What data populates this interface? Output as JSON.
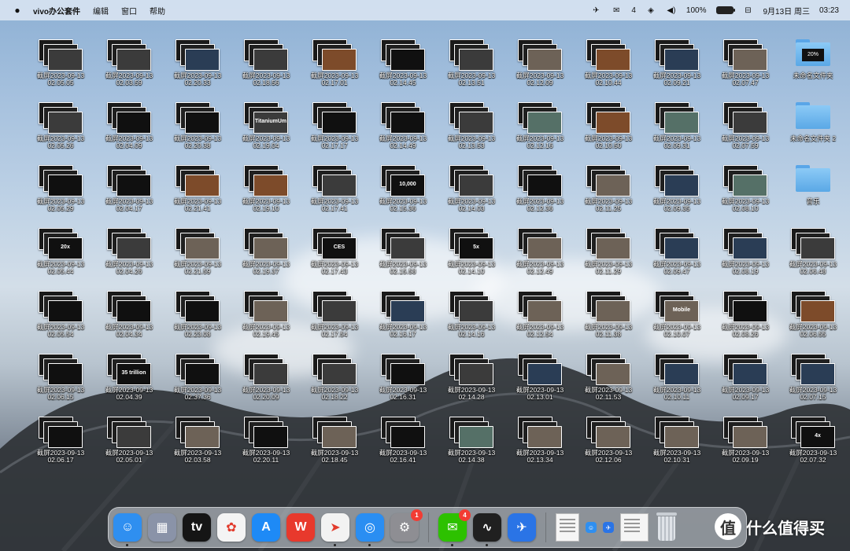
{
  "menubar": {
    "app_name": "vivo办公套件",
    "menus": [
      "编辑",
      "窗口",
      "帮助"
    ],
    "wechat_count": "4",
    "battery": "100%",
    "date": "9月13日 周三",
    "time": "03:23"
  },
  "desktop": {
    "columns": [
      [
        {
          "n1": "截屏",
          "n2": "2023-09-13",
          "n3": "02.05.05",
          "thumb": "",
          "v": 1
        },
        {
          "n1": "截屏",
          "n2": "2023-09-13",
          "n3": "02.05.26",
          "thumb": "",
          "v": 1
        },
        {
          "n1": "截屏",
          "n2": "2023-09-13",
          "n3": "02.05.29",
          "thumb": "",
          "v": 0
        },
        {
          "n1": "截屏",
          "n2": "2023-09-13",
          "n3": "02.05.44",
          "thumb": "20x",
          "v": 0
        },
        {
          "n1": "截屏",
          "n2": "2023-09-13",
          "n3": "02.05.54",
          "thumb": "",
          "v": 0
        },
        {
          "n1": "截屏",
          "n2": "2023-09-13",
          "n3": "02.06.15",
          "thumb": "",
          "v": 0
        },
        {
          "n1": "截屏",
          "n2": "2023-09-13",
          "n3": "02.06.17",
          "thumb": "",
          "v": 0
        }
      ],
      [
        {
          "n1": "截屏",
          "n2": "2023-09-13",
          "n3": "02.03.59",
          "thumb": "",
          "v": 1
        },
        {
          "n1": "截屏",
          "n2": "2023-09-13",
          "n3": "02.04.09",
          "thumb": "",
          "v": 0
        },
        {
          "n1": "截屏",
          "n2": "2023-09-13",
          "n3": "02.04.17",
          "thumb": "",
          "v": 0
        },
        {
          "n1": "截屏",
          "n2": "2023-09-13",
          "n3": "02.04.26",
          "thumb": "",
          "v": 1
        },
        {
          "n1": "截屏",
          "n2": "2023-09-13",
          "n3": "02.04.34",
          "thumb": "",
          "v": 0
        },
        {
          "n1": "截屏",
          "n2": "2023-09-13",
          "n3": "02.04.39",
          "thumb": "35 trillion",
          "v": 0
        },
        {
          "n1": "截屏",
          "n2": "2023-09-13",
          "n3": "02.05.01",
          "thumb": "",
          "v": 1
        }
      ],
      [
        {
          "n1": "截屏",
          "n2": "2023-09-13",
          "n3": "02.20.33",
          "thumb": "",
          "v": 3
        },
        {
          "n1": "截屏",
          "n2": "2023-09-13",
          "n3": "02.20.38",
          "thumb": "",
          "v": 0
        },
        {
          "n1": "截屏",
          "n2": "2023-09-13",
          "n3": "02.21.41",
          "thumb": "",
          "v": 4
        },
        {
          "n1": "截屏",
          "n2": "2023-09-13",
          "n3": "02.21.59",
          "thumb": "",
          "v": 2
        },
        {
          "n1": "截屏",
          "n2": "2023-09-13",
          "n3": "02.23.08",
          "thumb": "",
          "v": 0
        },
        {
          "n1": "截屏",
          "n2": "2023-09-13",
          "n3": "02.37.36",
          "thumb": "",
          "v": 0
        },
        {
          "n1": "截屏",
          "n2": "2023-09-13",
          "n3": "02.03.58",
          "thumb": "",
          "v": 2
        }
      ],
      [
        {
          "n1": "截屏",
          "n2": "2023-09-13",
          "n3": "02.18.56",
          "thumb": "",
          "v": 1
        },
        {
          "n1": "截屏",
          "n2": "2023-09-13",
          "n3": "02.19.04",
          "thumb": "TitaniumUm",
          "v": 1
        },
        {
          "n1": "截屏",
          "n2": "2023-09-13",
          "n3": "02.19.10",
          "thumb": "",
          "v": 4
        },
        {
          "n1": "截屏",
          "n2": "2023-09-13",
          "n3": "02.19.37",
          "thumb": "",
          "v": 2
        },
        {
          "n1": "截屏",
          "n2": "2023-09-13",
          "n3": "02.19.45",
          "thumb": "",
          "v": 2
        },
        {
          "n1": "截屏",
          "n2": "2023-09-13",
          "n3": "02.20.09",
          "thumb": "",
          "v": 1
        },
        {
          "n1": "截屏",
          "n2": "2023-09-13",
          "n3": "02.20.11",
          "thumb": "",
          "v": 0
        }
      ],
      [
        {
          "n1": "截屏",
          "n2": "2023-09-13",
          "n3": "02.17.01",
          "thumb": "",
          "v": 4
        },
        {
          "n1": "截屏",
          "n2": "2023-09-13",
          "n3": "02.17.17",
          "thumb": "",
          "v": 0
        },
        {
          "n1": "截屏",
          "n2": "2023-09-13",
          "n3": "02.17.41",
          "thumb": "",
          "v": 1
        },
        {
          "n1": "截屏",
          "n2": "2023-09-13",
          "n3": "02.17.43",
          "thumb": "CES",
          "v": 0
        },
        {
          "n1": "截屏",
          "n2": "2023-09-13",
          "n3": "02.17.54",
          "thumb": "",
          "v": 1
        },
        {
          "n1": "截屏",
          "n2": "2023-09-13",
          "n3": "02.18.22",
          "thumb": "",
          "v": 1
        },
        {
          "n1": "截屏",
          "n2": "2023-09-13",
          "n3": "02.18.45",
          "thumb": "",
          "v": 2
        }
      ],
      [
        {
          "n1": "截屏",
          "n2": "2023-09-13",
          "n3": "02.14.45",
          "thumb": "",
          "v": 0
        },
        {
          "n1": "截屏",
          "n2": "2023-09-13",
          "n3": "02.14.49",
          "thumb": "",
          "v": 0
        },
        {
          "n1": "截屏",
          "n2": "2023-09-13",
          "n3": "02.15.36",
          "thumb": "10,000",
          "v": 0
        },
        {
          "n1": "截屏",
          "n2": "2023-09-13",
          "n3": "02.15.58",
          "thumb": "",
          "v": 1
        },
        {
          "n1": "截屏",
          "n2": "2023-09-13",
          "n3": "02.16.17",
          "thumb": "",
          "v": 3
        },
        {
          "n1": "截屏",
          "n2": "2023-09-13",
          "n3": "02.16.31",
          "thumb": "",
          "v": 0
        },
        {
          "n1": "截屏",
          "n2": "2023-09-13",
          "n3": "02.16.41",
          "thumb": "",
          "v": 0
        }
      ],
      [
        {
          "n1": "截屏",
          "n2": "2023-09-13",
          "n3": "02.13.51",
          "thumb": "",
          "v": 1
        },
        {
          "n1": "截屏",
          "n2": "2023-09-13",
          "n3": "02.13.53",
          "thumb": "",
          "v": 1
        },
        {
          "n1": "截屏",
          "n2": "2023-09-13",
          "n3": "02.14.03",
          "thumb": "",
          "v": 1
        },
        {
          "n1": "截屏",
          "n2": "2023-09-13",
          "n3": "02.14.10",
          "thumb": "5x",
          "v": 0
        },
        {
          "n1": "截屏",
          "n2": "2023-09-13",
          "n3": "02.14.16",
          "thumb": "",
          "v": 1
        },
        {
          "n1": "截屏",
          "n2": "2023-09-13",
          "n3": "02.14.28",
          "thumb": "",
          "v": 1
        },
        {
          "n1": "截屏",
          "n2": "2023-09-13",
          "n3": "02.14.38",
          "thumb": "",
          "v": 5
        }
      ],
      [
        {
          "n1": "截屏",
          "n2": "2023-09-13",
          "n3": "02.12.09",
          "thumb": "",
          "v": 2
        },
        {
          "n1": "截屏",
          "n2": "2023-09-13",
          "n3": "02.12.16",
          "thumb": "",
          "v": 5
        },
        {
          "n1": "截屏",
          "n2": "2023-09-13",
          "n3": "02.12.36",
          "thumb": "",
          "v": 0
        },
        {
          "n1": "截屏",
          "n2": "2023-09-13",
          "n3": "02.12.49",
          "thumb": "",
          "v": 2
        },
        {
          "n1": "截屏",
          "n2": "2023-09-13",
          "n3": "02.12.54",
          "thumb": "",
          "v": 2
        },
        {
          "n1": "截屏",
          "n2": "2023-09-13",
          "n3": "02.13.01",
          "thumb": "",
          "v": 3
        },
        {
          "n1": "截屏",
          "n2": "2023-09-13",
          "n3": "02.13.34",
          "thumb": "",
          "v": 2
        }
      ],
      [
        {
          "n1": "截屏",
          "n2": "2023-09-13",
          "n3": "02.10.44",
          "thumb": "",
          "v": 4
        },
        {
          "n1": "截屏",
          "n2": "2023-09-13",
          "n3": "02.10.50",
          "thumb": "",
          "v": 4
        },
        {
          "n1": "截屏",
          "n2": "2023-09-13",
          "n3": "02.11.25",
          "thumb": "",
          "v": 2
        },
        {
          "n1": "截屏",
          "n2": "2023-09-13",
          "n3": "02.11.29",
          "thumb": "",
          "v": 2
        },
        {
          "n1": "截屏",
          "n2": "2023-09-13",
          "n3": "02.11.38",
          "thumb": "",
          "v": 2
        },
        {
          "n1": "截屏",
          "n2": "2023-09-13",
          "n3": "02.11.53",
          "thumb": "",
          "v": 2
        },
        {
          "n1": "截屏",
          "n2": "2023-09-13",
          "n3": "02.12.06",
          "thumb": "",
          "v": 2
        }
      ],
      [
        {
          "n1": "截屏",
          "n2": "2023-09-13",
          "n3": "02.09.21",
          "thumb": "",
          "v": 3
        },
        {
          "n1": "截屏",
          "n2": "2023-09-13",
          "n3": "02.09.31",
          "thumb": "",
          "v": 5
        },
        {
          "n1": "截屏",
          "n2": "2023-09-13",
          "n3": "02.09.35",
          "thumb": "",
          "v": 3
        },
        {
          "n1": "截屏",
          "n2": "2023-09-13",
          "n3": "02.09.47",
          "thumb": "",
          "v": 3
        },
        {
          "n1": "截屏",
          "n2": "2023-09-13",
          "n3": "02.10.07",
          "thumb": "Mobile",
          "v": 2
        },
        {
          "n1": "截屏",
          "n2": "2023-09-13",
          "n3": "02.10.11",
          "thumb": "",
          "v": 3
        },
        {
          "n1": "截屏",
          "n2": "2023-09-13",
          "n3": "02.10.31",
          "thumb": "",
          "v": 2
        }
      ],
      [
        {
          "n1": "截屏",
          "n2": "2023-09-13",
          "n3": "02.07.47",
          "thumb": "",
          "v": 2
        },
        {
          "n1": "截屏",
          "n2": "2023-09-13",
          "n3": "02.07.59",
          "thumb": "",
          "v": 1
        },
        {
          "n1": "截屏",
          "n2": "2023-09-13",
          "n3": "02.08.10",
          "thumb": "",
          "v": 5
        },
        {
          "n1": "截屏",
          "n2": "2023-09-13",
          "n3": "02.08.19",
          "thumb": "",
          "v": 3
        },
        {
          "n1": "截屏",
          "n2": "2023-09-13",
          "n3": "02.08.26",
          "thumb": "",
          "v": 0
        },
        {
          "n1": "截屏",
          "n2": "2023-09-13",
          "n3": "02.09.17",
          "thumb": "",
          "v": 3
        },
        {
          "n1": "截屏",
          "n2": "2023-09-13",
          "n3": "02.09.19",
          "thumb": "",
          "v": 2
        }
      ],
      [
        {
          "folder": true,
          "n1": "未命名文件夹",
          "n2": "",
          "n3": "",
          "thumb": "20%"
        },
        {
          "folder": true,
          "n1": "未命名文件夹 2",
          "n2": "",
          "n3": "",
          "thumb": ""
        },
        {
          "folder": true,
          "n1": "音乐",
          "n2": "",
          "n3": "",
          "thumb": ""
        },
        {
          "n1": "截屏",
          "n2": "2023-09-13",
          "n3": "02.06.48",
          "thumb": "",
          "v": 1
        },
        {
          "n1": "截屏",
          "n2": "2023-09-13",
          "n3": "02.06.55",
          "thumb": "",
          "v": 4
        },
        {
          "n1": "截屏",
          "n2": "2023-09-13",
          "n3": "02.07.15",
          "thumb": "",
          "v": 3
        },
        {
          "n1": "截屏",
          "n2": "2023-09-13",
          "n3": "02.07.32",
          "thumb": "4x",
          "v": 0
        }
      ]
    ]
  },
  "dock": {
    "apps": [
      {
        "name": "finder-icon",
        "glyph": "☺",
        "color": "#2f8ff0",
        "dot": true
      },
      {
        "name": "launchpad-icon",
        "glyph": "▦",
        "color": "#8a93a8"
      },
      {
        "name": "apple-tv-icon",
        "glyph": "tv",
        "color": "#151515"
      },
      {
        "name": "photos-icon",
        "glyph": "✿",
        "color": "#f4f4f4"
      },
      {
        "name": "app-store-icon",
        "glyph": "A",
        "color": "#1e8af6"
      },
      {
        "name": "wps-icon",
        "glyph": "W",
        "color": "#e8392c"
      },
      {
        "name": "vivo-office-icon",
        "glyph": "➤",
        "color": "#f2f2f2",
        "dot": true
      },
      {
        "name": "safari-icon",
        "glyph": "◎",
        "color": "#2a8ef2",
        "dot": true
      },
      {
        "name": "system-settings-icon",
        "glyph": "⚙",
        "color": "#8e8e93",
        "badge": "1"
      },
      {
        "name": "wechat-icon",
        "glyph": "✉",
        "color": "#2dc100",
        "badge": "4",
        "dot": true
      },
      {
        "name": "activity-monitor-icon",
        "glyph": "∿",
        "color": "#202020",
        "dot": true
      },
      {
        "name": "lark-icon",
        "glyph": "✈",
        "color": "#2a74e6"
      }
    ]
  },
  "watermark": {
    "glyph": "值",
    "text": "什么值得买"
  },
  "colors": {
    "menubar_bg": "#e4ecf6",
    "badge_red": "#f23c33"
  }
}
